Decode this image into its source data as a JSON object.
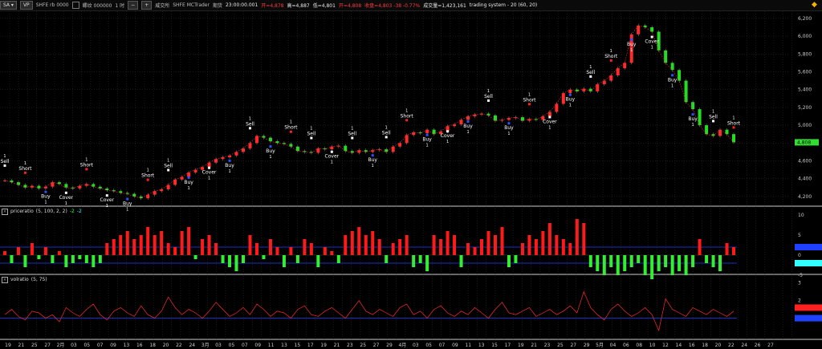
{
  "toolbar": {
    "symbol_btn": "SA ▾",
    "period_btn": "VP",
    "symbol": "SHFE rb 0000",
    "name": "螺纹 000000",
    "timeframe": "1 时",
    "zoom_minus": "−",
    "zoom_plus": "+",
    "exchange_label": "期货",
    "exchange_cn": "威交所",
    "platform": "SHFE  MCTrader",
    "subject": "期货",
    "time": "23:00:00.001",
    "open": "开=4,878",
    "high": "高=4,887",
    "low": "低=4,801",
    "close": "开=4,808",
    "change": "收盘=4,803  -38  -0.77%",
    "volume": "成交量=1,423,161",
    "strategy": "trading system - 20 (60,  20)"
  },
  "price_axis": {
    "labels": [
      "6,200",
      "6,000",
      "5,800",
      "5,600",
      "5,400",
      "5,200",
      "5,000",
      "4,800",
      "4,600",
      "4,400",
      "4,200"
    ],
    "current": "4,808",
    "current_color": "#33dd33"
  },
  "signals": [
    {
      "text": "Sell",
      "sub": "1"
    },
    {
      "text": "Short",
      "sub": "1"
    },
    {
      "text": "Buy",
      "sub": "1"
    },
    {
      "text": "Cover",
      "sub": "1"
    },
    {
      "text": "Short",
      "sub": "1"
    },
    {
      "text": "Cover",
      "sub": "1"
    },
    {
      "text": "Buy",
      "sub": "1"
    },
    {
      "text": "Short",
      "sub": "1"
    },
    {
      "text": "Sell",
      "sub": "1"
    },
    {
      "text": "Buy",
      "sub": "1"
    },
    {
      "text": "Cover",
      "sub": "1"
    },
    {
      "text": "Buy",
      "sub": "1"
    },
    {
      "text": "Sell",
      "sub": "1"
    },
    {
      "text": "Buy",
      "sub": "1"
    },
    {
      "text": "Short",
      "sub": "1"
    },
    {
      "text": "Sell",
      "sub": "1"
    },
    {
      "text": "Cover",
      "sub": "1"
    },
    {
      "text": "Sell",
      "sub": "1"
    },
    {
      "text": "Buy",
      "sub": "1"
    },
    {
      "text": "Sell",
      "sub": "1"
    },
    {
      "text": "Short",
      "sub": "1"
    },
    {
      "text": "Buy",
      "sub": "1"
    },
    {
      "text": "Cover",
      "sub": "1"
    },
    {
      "text": "Buy",
      "sub": "1"
    },
    {
      "text": "Sell",
      "sub": "1"
    },
    {
      "text": "Buy",
      "sub": "1"
    },
    {
      "text": "Short",
      "sub": "1"
    },
    {
      "text": "Cover",
      "sub": "1"
    },
    {
      "text": "Buy",
      "sub": "1"
    },
    {
      "text": "Sell",
      "sub": "1"
    },
    {
      "text": "Short",
      "sub": "1"
    },
    {
      "text": "Buy",
      "sub": "1"
    },
    {
      "text": "Cover",
      "sub": "1"
    },
    {
      "text": "Buy",
      "sub": "1"
    },
    {
      "text": "Buy",
      "sub": "1"
    },
    {
      "text": "Sell",
      "sub": "1"
    },
    {
      "text": "Short",
      "sub": "1"
    }
  ],
  "panel2": {
    "title": "priceratio",
    "params": "(5, 100, 2, 2)",
    "v1": "-2",
    "v2": "-2",
    "axis": [
      "10",
      "5",
      "0",
      "-5"
    ]
  },
  "panel3": {
    "title": "volratio",
    "params": "(5, 75)",
    "axis": [
      "3",
      "2",
      "1"
    ]
  },
  "date_axis": [
    "19",
    "21",
    "25",
    "27",
    "2月",
    "03",
    "05",
    "07",
    "09",
    "13",
    "16",
    "18",
    "20",
    "22",
    "24",
    "3月",
    "03",
    "05",
    "07",
    "09",
    "11",
    "13",
    "15",
    "17",
    "19",
    "21",
    "23",
    "25",
    "27",
    "29",
    "4月",
    "03",
    "05",
    "07",
    "09",
    "11",
    "13",
    "15",
    "17",
    "19",
    "21",
    "23",
    "25",
    "27",
    "29",
    "5月",
    "04",
    "06",
    "08",
    "10",
    "12",
    "14",
    "16",
    "18",
    "20",
    "22",
    "24",
    "26",
    "27"
  ],
  "chart_data": {
    "type": "line",
    "title": "",
    "ylim": [
      4100,
      6280
    ],
    "close": [
      4380,
      4360,
      4330,
      4300,
      4320,
      4290,
      4310,
      4360,
      4340,
      4300,
      4290,
      4320,
      4340,
      4310,
      4290,
      4270,
      4260,
      4240,
      4230,
      4200,
      4180,
      4220,
      4260,
      4280,
      4330,
      4390,
      4420,
      4470,
      4500,
      4530,
      4580,
      4620,
      4640,
      4660,
      4700,
      4740,
      4800,
      4880,
      4860,
      4820,
      4800,
      4790,
      4760,
      4710,
      4700,
      4690,
      4740,
      4730,
      4760,
      4770,
      4710,
      4690,
      4720,
      4700,
      4720,
      4730,
      4700,
      4760,
      4800,
      4890,
      4920,
      4910,
      4950,
      4900,
      4930,
      4990,
      5010,
      5060,
      5100,
      5120,
      5130,
      5110,
      5050,
      5060,
      5080,
      5090,
      5050,
      5070,
      5060,
      5100,
      5150,
      5240,
      5360,
      5400,
      5380,
      5410,
      5380,
      5460,
      5500,
      5560,
      5640,
      5700,
      6020,
      6120,
      6100,
      6050,
      5840,
      5700,
      5620,
      5500,
      5260,
      5180,
      5000,
      4900,
      4880,
      4950,
      4900,
      4808
    ],
    "priceratio": [
      1,
      -2,
      2,
      -3,
      3,
      -1,
      2,
      -2,
      1,
      -3,
      -2,
      -1,
      -2,
      -3,
      -2,
      3,
      4,
      5,
      6,
      4,
      5,
      7,
      5,
      6,
      3,
      2,
      6,
      7,
      -1,
      4,
      5,
      3,
      -2,
      -3,
      -4,
      -2,
      5,
      3,
      -1,
      4,
      2,
      -3,
      2,
      -2,
      4,
      3,
      -3,
      2,
      1,
      -2,
      5,
      6,
      7,
      5,
      6,
      4,
      -2,
      3,
      4,
      5,
      -3,
      -2,
      -4,
      5,
      4,
      6,
      5,
      -3,
      3,
      2,
      4,
      6,
      5,
      7,
      -3,
      -2,
      3,
      5,
      4,
      6,
      8,
      5,
      4,
      3,
      9,
      8,
      -3,
      -4,
      -5,
      -3,
      -5,
      -4,
      -3,
      -2,
      -5,
      -6,
      -4,
      -3,
      -5,
      -4,
      -5,
      -3,
      4,
      -2,
      -3,
      -4,
      3,
      2
    ],
    "volratio": [
      1.2,
      1.5,
      1.1,
      0.9,
      1.4,
      1.3,
      1.0,
      1.2,
      0.8,
      1.6,
      1.3,
      1.1,
      1.5,
      1.8,
      1.2,
      0.9,
      1.4,
      1.6,
      1.3,
      1.1,
      1.7,
      1.2,
      1.0,
      1.4,
      2.2,
      1.6,
      1.2,
      1.5,
      1.3,
      1.0,
      1.4,
      1.9,
      1.5,
      1.1,
      1.3,
      1.6,
      1.2,
      1.8,
      1.5,
      1.1,
      1.4,
      1.3,
      1.0,
      1.5,
      1.7,
      1.2,
      1.1,
      1.4,
      1.6,
      1.3,
      1.0,
      1.5,
      2.0,
      1.4,
      1.2,
      1.5,
      1.3,
      1.1,
      1.6,
      1.8,
      1.2,
      1.4,
      1.0,
      1.5,
      1.7,
      1.3,
      1.1,
      1.4,
      1.2,
      1.6,
      1.3,
      1.0,
      1.5,
      1.9,
      1.3,
      1.2,
      1.4,
      1.6,
      1.1,
      1.3,
      1.5,
      1.2,
      1.4,
      1.7,
      1.3,
      2.5,
      1.6,
      1.2,
      0.9,
      1.5,
      1.8,
      1.4,
      1.1,
      1.3,
      1.6,
      1.2,
      0.3,
      2.1,
      1.5,
      1.3,
      1.1,
      1.6,
      1.4,
      1.2,
      1.5,
      1.3,
      1.1,
      1.4
    ]
  }
}
